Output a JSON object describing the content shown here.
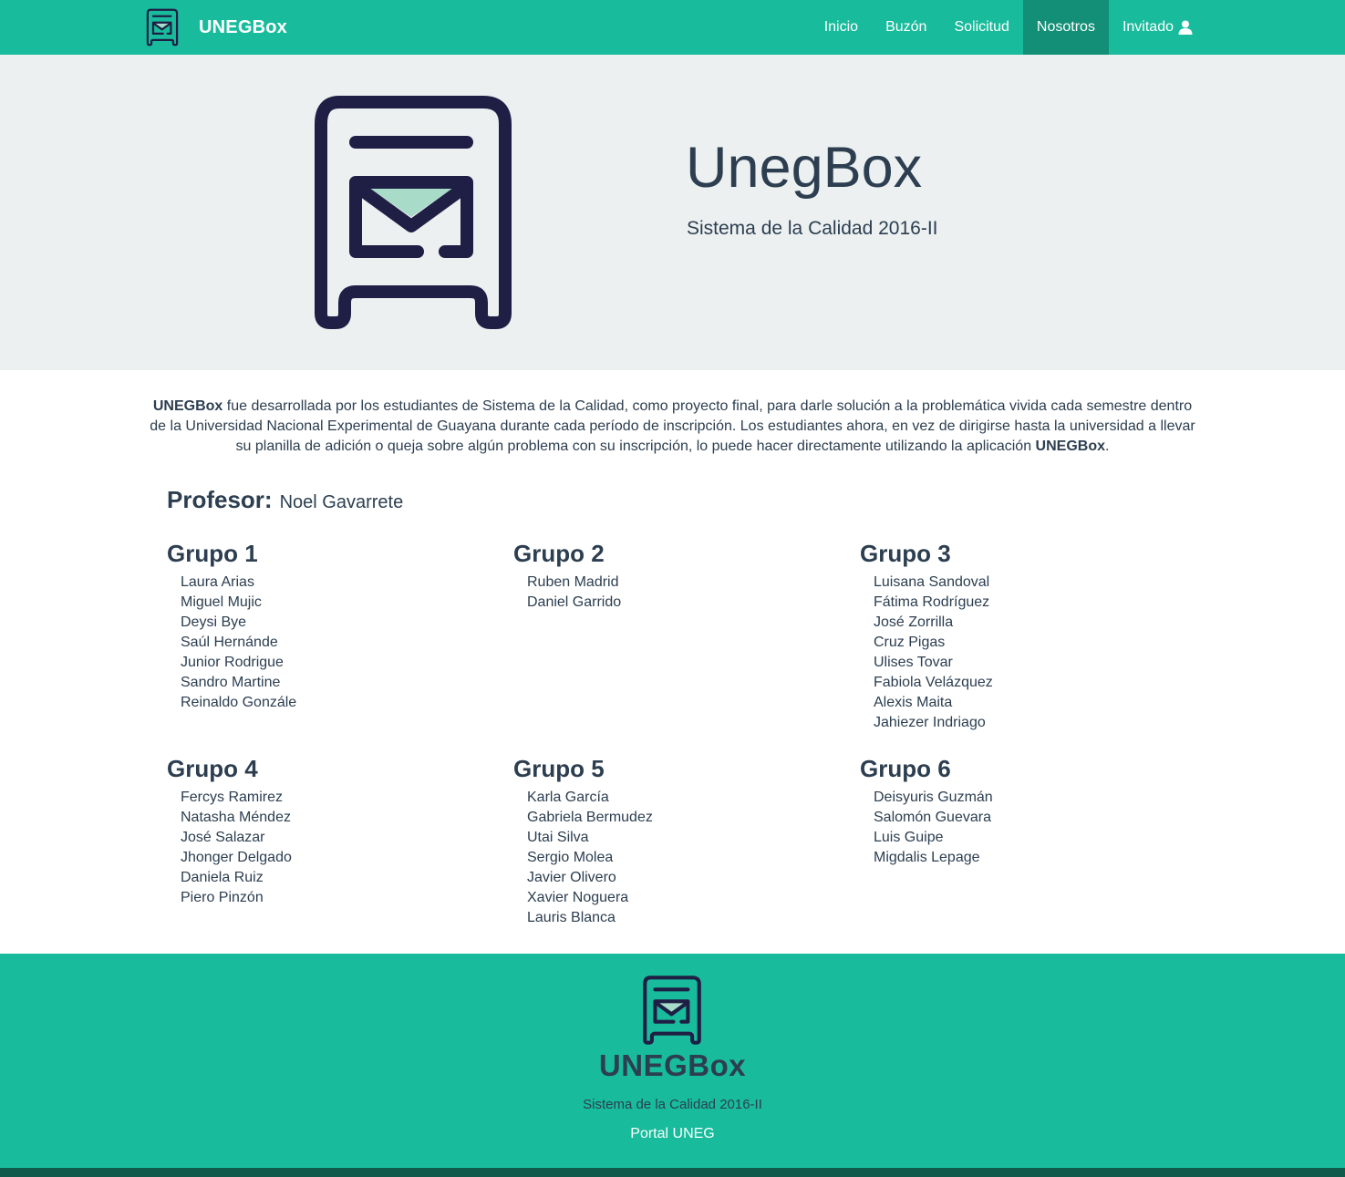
{
  "navbar": {
    "brand": "UNEGBox",
    "items": [
      {
        "label": "Inicio"
      },
      {
        "label": "Buzón"
      },
      {
        "label": "Solicitud"
      },
      {
        "label": "Nosotros"
      },
      {
        "label": "Invitado"
      }
    ],
    "active_item": "Nosotros",
    "brand_icon": "mailbox-icon",
    "user_icon": "user-icon"
  },
  "hero": {
    "title": "UnegBox",
    "subtitle": "Sistema de la Calidad 2016-II",
    "logo_icon": "mailbox-icon"
  },
  "about": {
    "brand_strong": "UNEGBox",
    "text": " fue desarrollada por los estudiantes de Sistema de la Calidad, como proyecto final, para darle solución a la problemática vivida cada semestre dentro de la Universidad Nacional Experimental de Guayana durante cada período de inscripción. Los estudiantes ahora, en vez de dirigirse hasta la universidad a llevar su planilla de adición o queja sobre algún problema con su inscripción, lo puede hacer directamente utilizando la aplicación ",
    "brand_strong_end": "UNEGBox",
    "end": "."
  },
  "profesor": {
    "label": "Profesor:",
    "name": "Noel Gavarrete"
  },
  "groups": [
    {
      "title": "Grupo 1",
      "members": [
        "Laura Arias",
        "Miguel Mujic",
        "Deysi Bye",
        "Saúl Hernánde",
        "Junior Rodrigue",
        "Sandro Martine",
        "Reinaldo Gonzále"
      ]
    },
    {
      "title": "Grupo 2",
      "members": [
        "Ruben Madrid",
        "Daniel Garrido"
      ]
    },
    {
      "title": "Grupo 3",
      "members": [
        "Luisana Sandoval",
        "Fátima Rodríguez",
        "José Zorrilla",
        "Cruz Pigas",
        "Ulises Tovar",
        "Fabiola Velázquez",
        "Alexis Maita",
        "Jahiezer Indriago"
      ]
    },
    {
      "title": "Grupo 4",
      "members": [
        "Fercys Ramirez",
        "Natasha Méndez",
        "José Salazar",
        "Jhonger Delgado",
        "Daniela Ruiz",
        "Piero Pinzón"
      ]
    },
    {
      "title": "Grupo 5",
      "members": [
        "Karla García",
        "Gabriela Bermudez",
        "Utai Silva",
        "Sergio Molea",
        "Javier Olivero",
        "Xavier Noguera",
        "Lauris Blanca"
      ]
    },
    {
      "title": "Grupo 6",
      "members": [
        "Deisyuris Guzmán",
        "Salomón Guevara",
        "Luis Guipe",
        "Migdalis Lepage"
      ]
    }
  ],
  "footer": {
    "brand": "UNEGBox",
    "subtitle": "Sistema de la Calidad 2016-II",
    "link": "Portal UNEG",
    "logo_icon": "mailbox-icon"
  },
  "colors": {
    "primary": "#18bc9c",
    "primary_dark": "#128f76",
    "text": "#2c3e50",
    "hero_bg": "#ecf0f1",
    "logo_stroke": "#1f1f45",
    "logo_accent": "#a8dcc8",
    "bottom_bar": "#0f5a4b"
  }
}
